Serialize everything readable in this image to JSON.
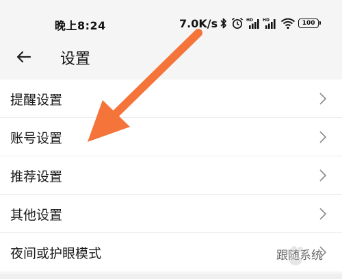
{
  "status_bar": {
    "time": "晚上8:24",
    "net_speed": "7.0K/s",
    "battery_level": "100",
    "icons": [
      "bluetooth-icon",
      "alarm-icon",
      "signal-hd-icon",
      "signal-hd-icon",
      "wifi-icon",
      "battery-icon"
    ]
  },
  "header": {
    "back_icon": "arrow-left-icon",
    "title": "设置"
  },
  "settings": {
    "items": [
      {
        "label": "提醒设置"
      },
      {
        "label": "账号设置"
      },
      {
        "label": "推荐设置"
      },
      {
        "label": "其他设置"
      },
      {
        "label": "夜间或护眼模式",
        "value": "跟随系统"
      }
    ]
  },
  "annotation": {
    "arrow_color": "#f4743a"
  }
}
